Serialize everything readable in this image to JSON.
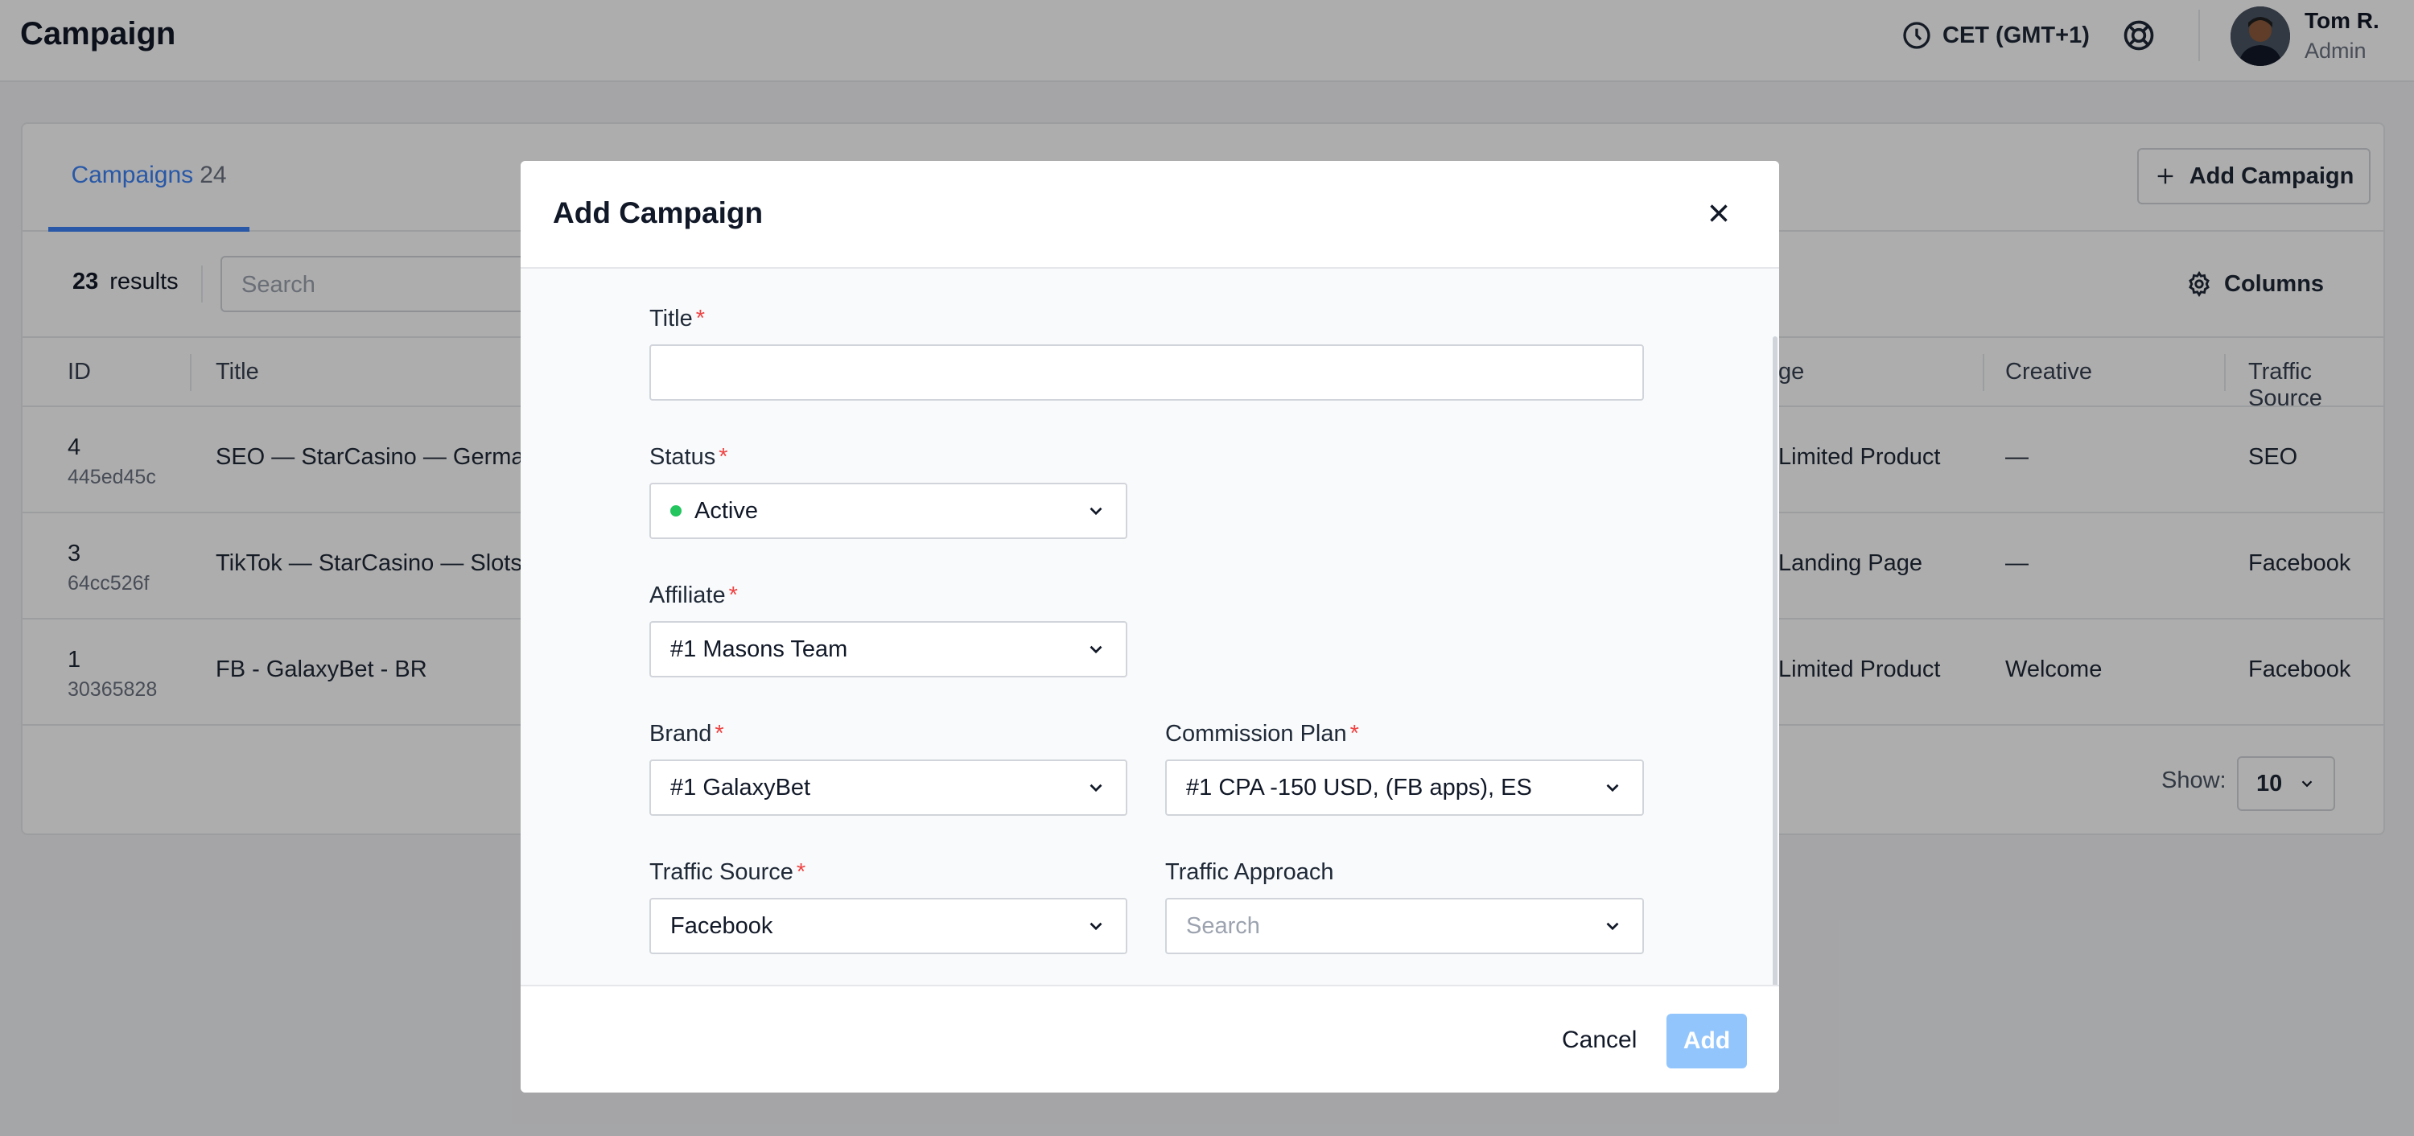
{
  "header": {
    "title": "Campaign",
    "timezone": "CET (GMT+1)",
    "user": {
      "name": "Tom R.",
      "role": "Admin"
    }
  },
  "tabs": [
    {
      "label": "Campaigns",
      "count": "24"
    }
  ],
  "toolbar": {
    "add_campaign_label": "Add Campaign",
    "results_count": "23",
    "results_label": "results",
    "search_placeholder": "Search",
    "columns_label": "Columns"
  },
  "table": {
    "columns": [
      "ID",
      "Title",
      "ge",
      "Creative",
      "Traffic Source"
    ],
    "rows": [
      {
        "id": "4",
        "hash": "445ed45c",
        "title": "SEO — StarCasino — German",
        "page": "Limited Product",
        "creative": "—",
        "traffic_source": "SEO"
      },
      {
        "id": "3",
        "hash": "64cc526f",
        "title": "TikTok — StarCasino — Slots",
        "page": "Landing Page",
        "creative": "—",
        "traffic_source": "Facebook"
      },
      {
        "id": "1",
        "hash": "30365828",
        "title": "FB - GalaxyBet - BR",
        "page": "Limited Product",
        "creative": "Welcome",
        "traffic_source": "Facebook"
      }
    ],
    "show_label": "Show:",
    "page_size": "10"
  },
  "modal": {
    "title": "Add Campaign",
    "fields": {
      "title": {
        "label": "Title",
        "value": ""
      },
      "status": {
        "label": "Status",
        "value": "Active",
        "status_color": "#22c55e"
      },
      "affiliate": {
        "label": "Affiliate",
        "value": "#1 Masons Team"
      },
      "brand": {
        "label": "Brand",
        "value": "#1 GalaxyBet"
      },
      "commission_plan": {
        "label": "Commission Plan",
        "value": "#1 CPA -150 USD, (FB apps), ES"
      },
      "traffic_source": {
        "label": "Traffic Source",
        "value": "Facebook"
      },
      "traffic_approach": {
        "label": "Traffic Approach",
        "placeholder": "Search"
      }
    },
    "required_marker": "*",
    "cancel_label": "Cancel",
    "add_label": "Add"
  },
  "colors": {
    "accent": "#3b82f6",
    "required": "#ef4444",
    "add_button_disabled": "#93c5fd"
  }
}
